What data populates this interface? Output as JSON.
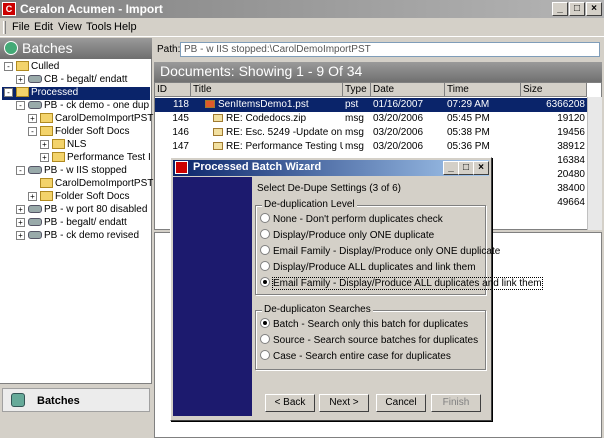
{
  "window": {
    "title": "Ceralon Acumen - Import"
  },
  "menu": [
    "File",
    "Edit",
    "View",
    "Tools",
    "Help"
  ],
  "left_panel": {
    "header": "Batches",
    "tree": [
      {
        "label": "Culled",
        "indent": 0,
        "type": "folder",
        "expander": "-"
      },
      {
        "label": "CB - begalt/ endatt",
        "indent": 1,
        "type": "batch",
        "expander": "+"
      },
      {
        "label": "Processed",
        "indent": 0,
        "type": "folder",
        "expander": "-",
        "selected": true
      },
      {
        "label": "PB - ck demo - one dup",
        "indent": 1,
        "type": "batch",
        "expander": "-"
      },
      {
        "label": "CarolDemoImportPST",
        "indent": 2,
        "type": "folder",
        "expander": "+"
      },
      {
        "label": "Folder Soft Docs",
        "indent": 2,
        "type": "folder",
        "expander": "-"
      },
      {
        "label": "NLS",
        "indent": 3,
        "type": "folder",
        "expander": "+"
      },
      {
        "label": "Performance Test I",
        "indent": 3,
        "type": "folder",
        "expander": "+"
      },
      {
        "label": "PB - w IIS stopped",
        "indent": 1,
        "type": "batch",
        "expander": "-"
      },
      {
        "label": "CarolDemoImportPST",
        "indent": 2,
        "type": "folder",
        "expander": ""
      },
      {
        "label": "Folder Soft Docs",
        "indent": 2,
        "type": "folder",
        "expander": "+"
      },
      {
        "label": "PB - w port 80 disabled",
        "indent": 1,
        "type": "batch",
        "expander": "+"
      },
      {
        "label": "PB - begalt/ endatt",
        "indent": 1,
        "type": "batch",
        "expander": "+"
      },
      {
        "label": "PB - ck demo revised",
        "indent": 1,
        "type": "batch",
        "expander": "+"
      }
    ],
    "bottom_button": "Batches"
  },
  "path": {
    "label": "Path:",
    "value": "PB - w IIS stopped:\\CarolDemoImportPST"
  },
  "documents": {
    "header": "Documents: Showing 1 - 9 Of 34",
    "columns": [
      "ID",
      "Title",
      "Type",
      "Date",
      "Time",
      "Size"
    ],
    "rows": [
      {
        "id": "118",
        "title": "SenItemsDemo1.pst",
        "type": "pst",
        "date": "01/16/2007",
        "time": "07:29 AM",
        "size": "6366208",
        "selected": true,
        "level": 0
      },
      {
        "id": "145",
        "title": "RE: Codedocs.zip",
        "type": "msg",
        "date": "03/20/2006",
        "time": "05:45 PM",
        "size": "19120",
        "level": 1
      },
      {
        "id": "146",
        "title": "RE: Esc. 5249 -Update on FC a",
        "type": "msg",
        "date": "03/20/2006",
        "time": "05:38 PM",
        "size": "19456",
        "level": 1
      },
      {
        "id": "147",
        "title": "RE: Performance Testing US Al",
        "type": "msg",
        "date": "03/20/2006",
        "time": "05:36 PM",
        "size": "38912",
        "level": 1
      },
      {
        "id": "",
        "title": "",
        "type": "",
        "date": "",
        "time": "",
        "size": "16384",
        "level": 1
      },
      {
        "id": "",
        "title": "",
        "type": "",
        "date": "",
        "time": "",
        "size": "20480",
        "level": 1
      },
      {
        "id": "",
        "title": "",
        "type": "",
        "date": "",
        "time": "",
        "size": "38400",
        "level": 1
      },
      {
        "id": "",
        "title": "",
        "type": "",
        "date": "",
        "time": "",
        "size": "49664",
        "level": 1
      }
    ]
  },
  "wizard": {
    "title": "Processed Batch Wizard",
    "step": "Select De-Dupe Settings (3 of 6)",
    "level_group": "De-duplication Level",
    "level_options": [
      {
        "label": "None - Don't perform duplicates check",
        "checked": false
      },
      {
        "label": "Display/Produce only ONE duplicate",
        "checked": false
      },
      {
        "label": "Email Family - Display/Produce only ONE duplicate",
        "checked": false
      },
      {
        "label": "Display/Produce ALL duplicates and link them",
        "checked": false
      },
      {
        "label": "Email Family - Display/Produce ALL duplicates and link them",
        "checked": true
      }
    ],
    "search_group": "De-duplicaton Searches",
    "search_options": [
      {
        "label": "Batch - Search only this batch for duplicates",
        "checked": true
      },
      {
        "label": "Source - Search source batches for duplicates",
        "checked": false
      },
      {
        "label": "Case - Search entire case for duplicates",
        "checked": false
      }
    ],
    "buttons": {
      "back": "< Back",
      "next": "Next >",
      "cancel": "Cancel",
      "finish": "Finish"
    }
  }
}
